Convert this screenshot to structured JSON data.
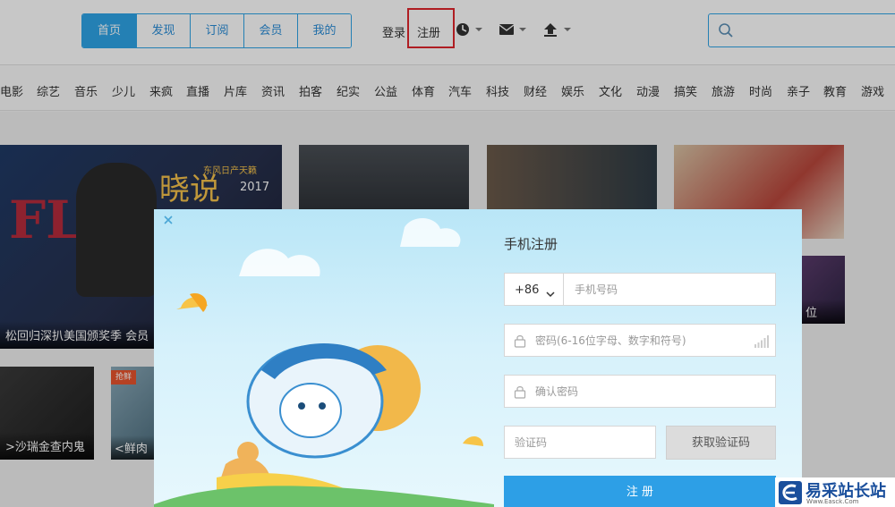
{
  "header": {
    "tabs": [
      "首页",
      "发现",
      "订阅",
      "会员",
      "我的"
    ],
    "login": "登录",
    "register": "注册",
    "search_placeholder": ""
  },
  "categories": [
    "电影",
    "综艺",
    "音乐",
    "少儿",
    "来疯",
    "直播",
    "片库",
    "资讯",
    "拍客",
    "纪实",
    "公益",
    "体育",
    "汽车",
    "科技",
    "财经",
    "娱乐",
    "文化",
    "动漫",
    "搞笑",
    "旅游",
    "时尚",
    "亲子",
    "教育",
    "游戏"
  ],
  "content": {
    "hero_overlay_text": "晓说",
    "hero_badge": "东风日产天籁",
    "hero_year": "2017",
    "hero_caption": "松回归深扒美国颁奖季 会员",
    "small_caption_1": ">沙瑞金查内鬼",
    "small_caption_2": "<鲜肉",
    "small_badge": "抢鲜",
    "right_caption": "位"
  },
  "modal": {
    "title": "手机注册",
    "country_code": "+86",
    "phone_placeholder": "手机号码",
    "password_placeholder": "密码(6-16位字母、数字和符号)",
    "confirm_placeholder": "确认密码",
    "code_placeholder": "验证码",
    "get_code_label": "获取验证码",
    "submit_label": "注 册"
  },
  "watermark": {
    "text": "易采站长站",
    "sub": "Www.Easck.Com"
  },
  "colors": {
    "accent": "#2fa4e7",
    "highlight_box": "#e0262c",
    "submit": "#2d9fe6"
  }
}
